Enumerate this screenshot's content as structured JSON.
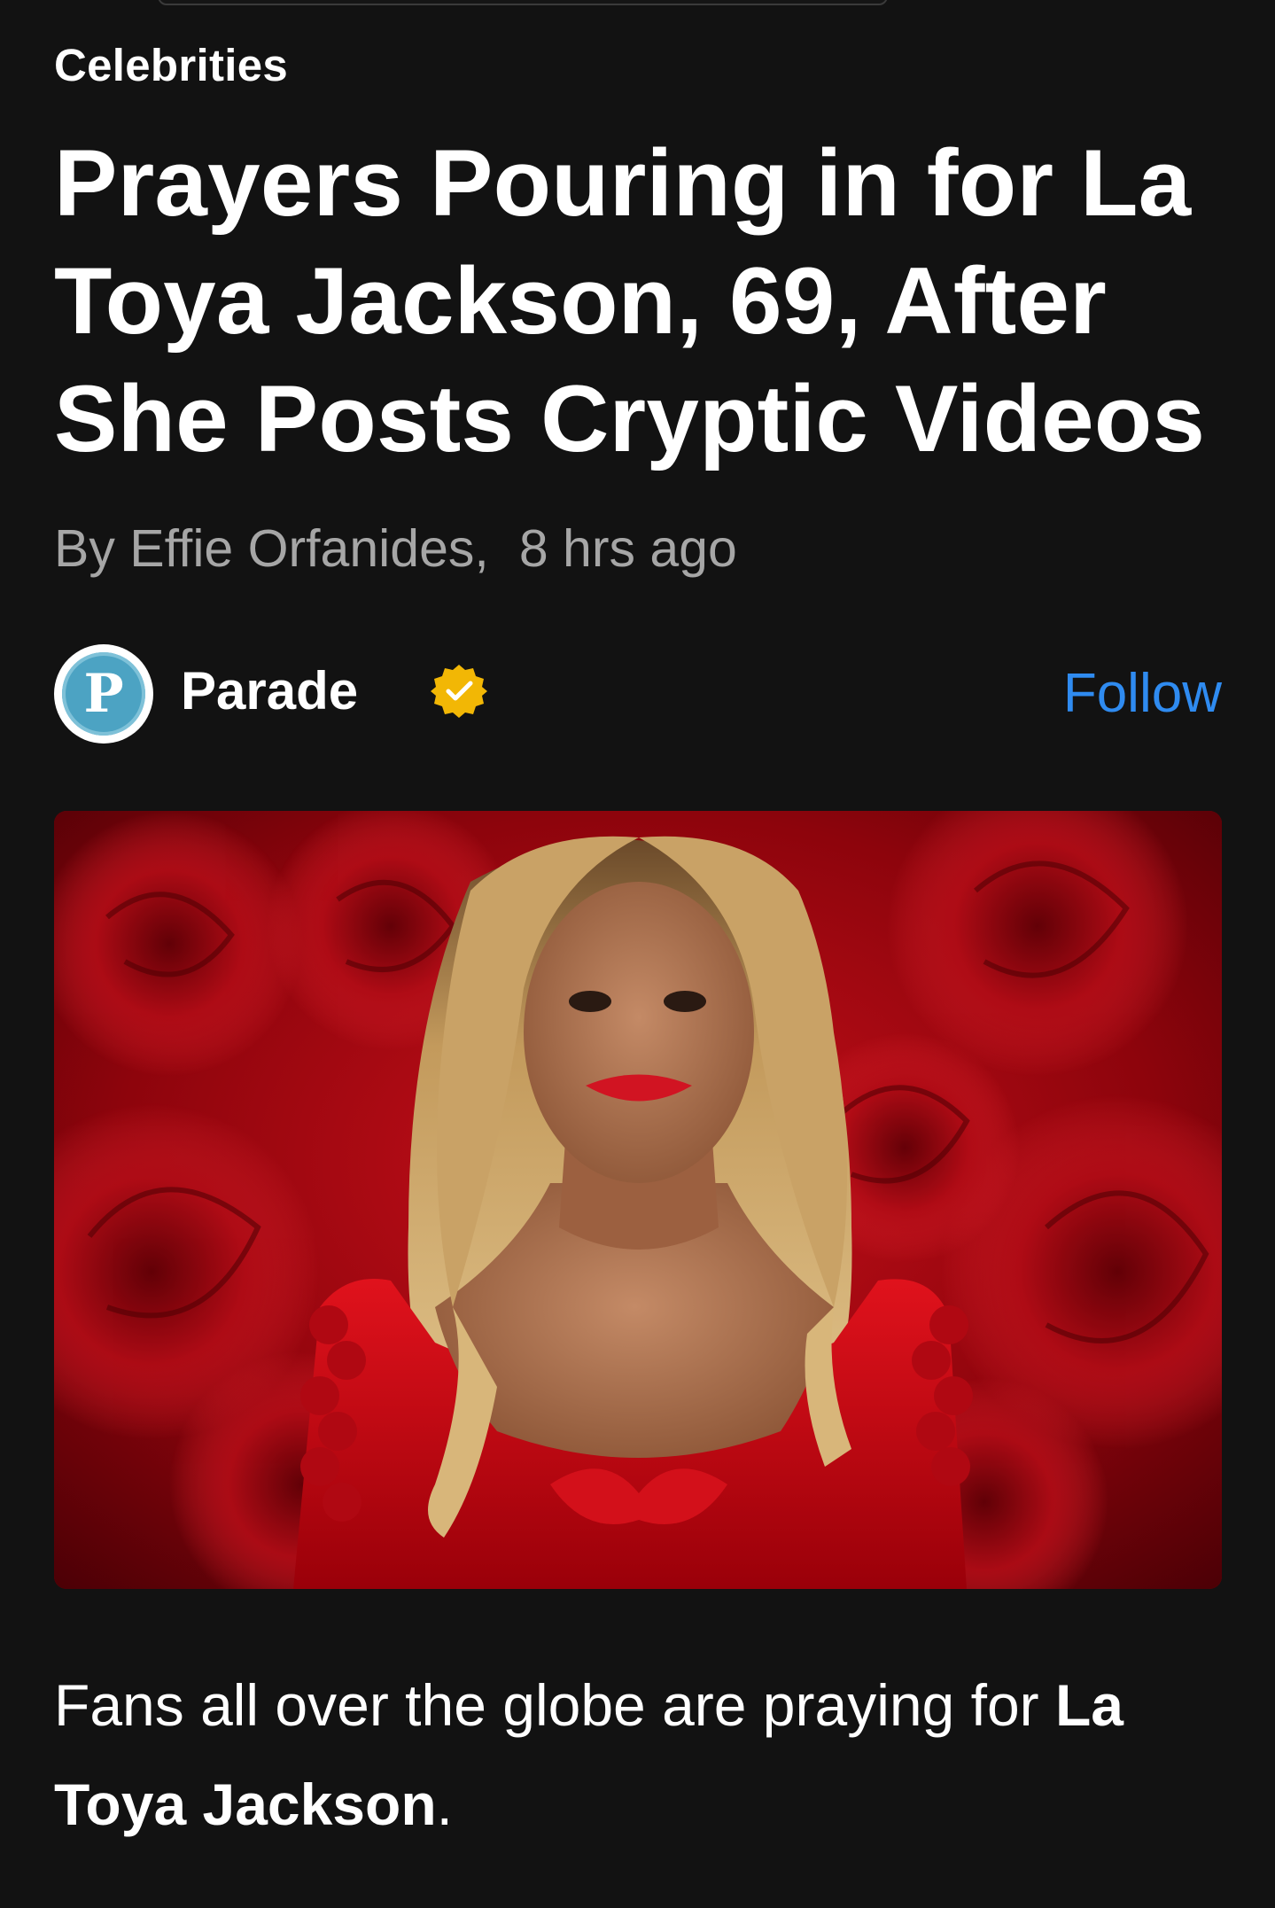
{
  "article": {
    "category": "Celebrities",
    "headline": "Prayers Pouring in for La Toya Jackson, 69, After She Posts Cryptic Videos",
    "author": "By Effie Orfanides,",
    "timestamp": "8 hrs ago",
    "lead_text": "Fans all over the globe are praying for ",
    "lead_bold": "La Toya Jackson",
    "lead_end": "."
  },
  "publisher": {
    "logo_letter": "P",
    "name": "Parade",
    "verified_icon": "verified-badge-icon",
    "follow_label": "Follow"
  },
  "colors": {
    "background": "#121212",
    "follow_blue": "#2f8bf0",
    "byline_gray": "#a6a6a6",
    "verified_gold": "#f2b705",
    "logo_blue": "#4ca3c3"
  }
}
